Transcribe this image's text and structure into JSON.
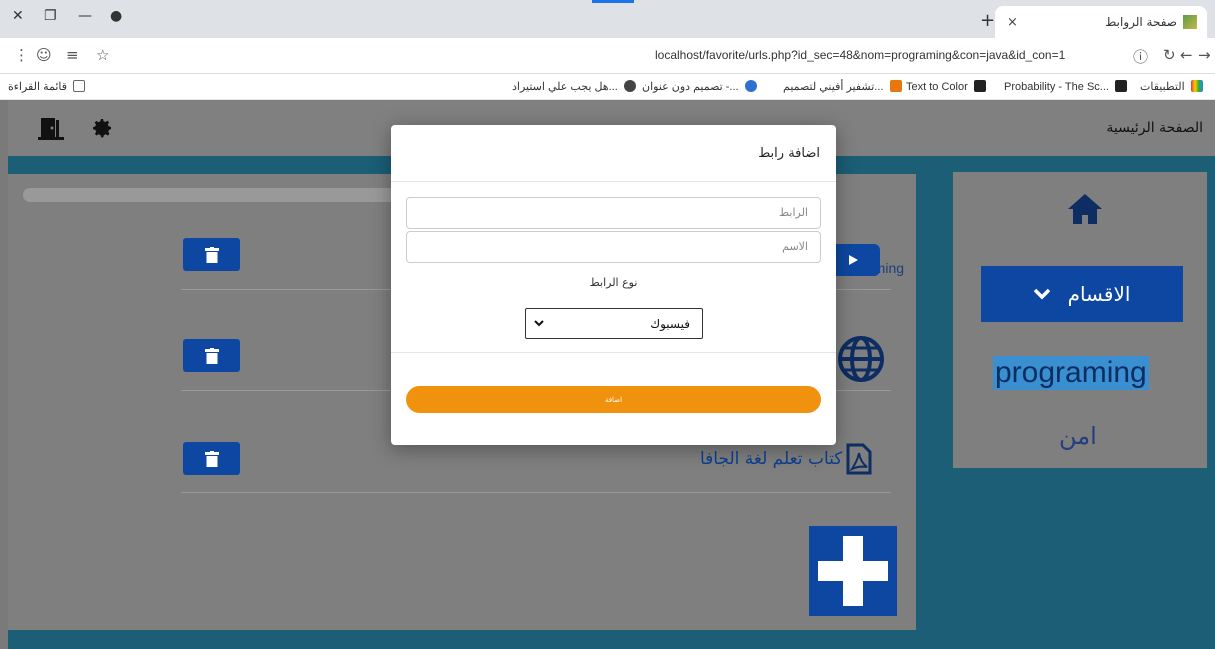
{
  "browser": {
    "tab_title": "صفحة الروابط",
    "tab_close": "×",
    "new_tab": "+",
    "url": "localhost/favorite/urls.php?id_sec=48&nom=programing&con=java&id_con=1",
    "bookmarks": [
      "التطبيقات",
      "Probability - The Sc...",
      "Text to Color",
      "تشفير أفيني لتصميم...",
      "تصميم دون عنوان -...",
      "هل يجب علي استيراد..."
    ],
    "reading_list": "قائمة القراءة"
  },
  "header": {
    "home_link": "الصفحة الرئيسية"
  },
  "sidebar": {
    "categories_button": "الاقسام",
    "selected_category": "programing",
    "other_category": "امن"
  },
  "main": {
    "partial_text": "rograming",
    "pdf_link": "كتاب تعلم لغة الجافا"
  },
  "modal": {
    "title": "اضافة رابط",
    "url_placeholder": "الرابط",
    "name_placeholder": "الاسم",
    "type_label": "نوع الرابط",
    "type_selected": "فيسبوك",
    "submit_label": "اضافة"
  },
  "colors": {
    "primary": "#0d47a1",
    "accent_orange": "#f0920e",
    "page_blue": "#1b5e76"
  }
}
